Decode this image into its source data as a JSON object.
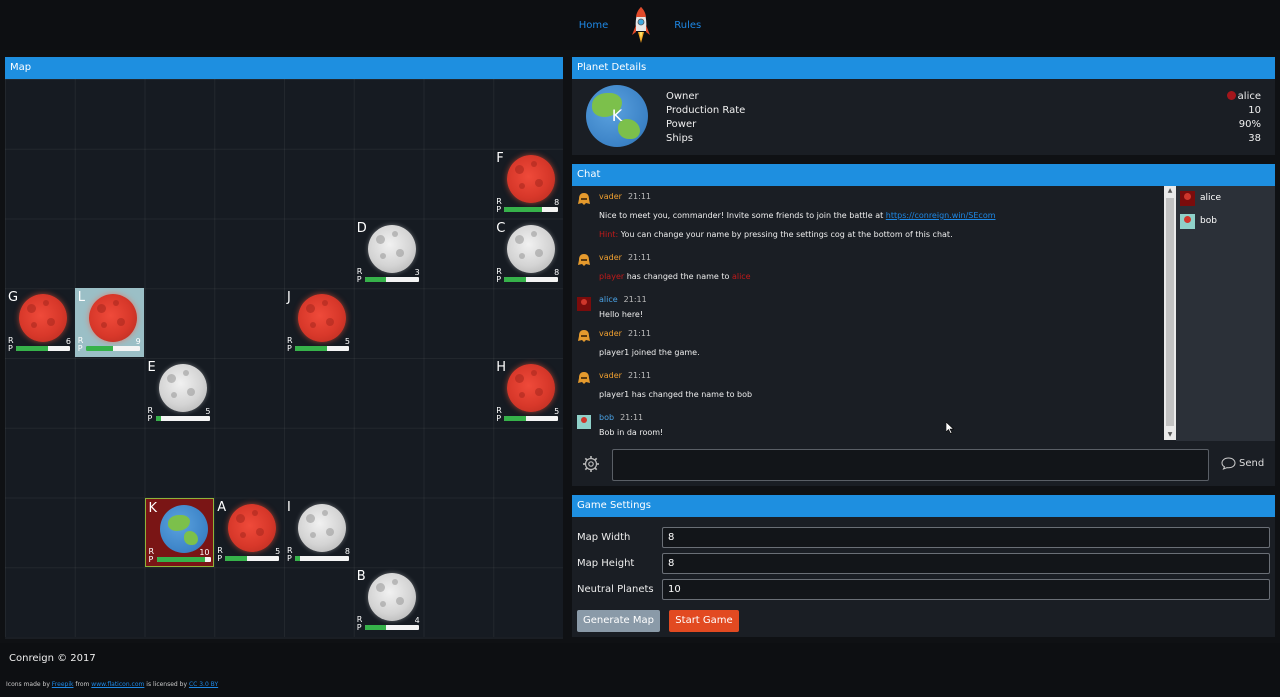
{
  "nav": {
    "home": "Home",
    "rules": "Rules"
  },
  "map": {
    "title": "Map",
    "cells": [
      {
        "letter": "F",
        "col": 7,
        "row": 1,
        "type": "red",
        "ships": "8",
        "production": 0.7
      },
      {
        "letter": "D",
        "col": 5,
        "row": 2,
        "type": "grey",
        "ships": "3",
        "production": 0.4
      },
      {
        "letter": "C",
        "col": 7,
        "row": 2,
        "type": "grey",
        "ships": "8",
        "production": 0.4
      },
      {
        "letter": "G",
        "col": 0,
        "row": 3,
        "type": "red",
        "ships": "6",
        "production": 0.6
      },
      {
        "letter": "L",
        "col": 1,
        "row": 3,
        "type": "red",
        "ships": "9",
        "production": 0.5,
        "highlight": "l"
      },
      {
        "letter": "J",
        "col": 4,
        "row": 3,
        "type": "red",
        "ships": "5",
        "production": 0.6
      },
      {
        "letter": "E",
        "col": 2,
        "row": 4,
        "type": "grey",
        "ships": "5",
        "production": 0.1
      },
      {
        "letter": "H",
        "col": 7,
        "row": 4,
        "type": "red",
        "ships": "5",
        "production": 0.4
      },
      {
        "letter": "K",
        "col": 2,
        "row": 6,
        "type": "earth",
        "ships": "10",
        "production": 0.9,
        "highlight": "k"
      },
      {
        "letter": "A",
        "col": 3,
        "row": 6,
        "type": "red",
        "ships": "5",
        "production": 0.4
      },
      {
        "letter": "I",
        "col": 4,
        "row": 6,
        "type": "grey",
        "ships": "8",
        "production": 0.1
      },
      {
        "letter": "B",
        "col": 5,
        "row": 7,
        "type": "grey",
        "ships": "4",
        "production": 0.4
      }
    ],
    "r_label": "R",
    "p_label": "P"
  },
  "details": {
    "title": "Planet Details",
    "planet_letter": "K",
    "labels": [
      "Owner",
      "Production Rate",
      "Power",
      "Ships"
    ],
    "owner": "alice",
    "production_rate": "10",
    "power": "90%",
    "ships": "38"
  },
  "chat": {
    "title": "Chat",
    "messages": {
      "m1_name": "vader",
      "m1_time": "21:11",
      "m1_text": "Nice to meet you, commander! Invite some friends to join the battle at",
      "m1_link": "https://conreign.win/SEcom",
      "m1_hint_label": "Hint:",
      "m1_hint": "You can change your name by pressing the settings cog at the bottom of this chat.",
      "m2_name": "vader",
      "m2_time": "21:11",
      "m2_old": "player",
      "m2_text": "has changed the name to",
      "m2_new": "alice",
      "m3_name": "alice",
      "m3_time": "21:11",
      "m3_text": "Hello here!",
      "m4_name": "vader",
      "m4_time": "21:11",
      "m4_text": "player1 joined the game.",
      "m5_name": "vader",
      "m5_time": "21:11",
      "m5_text": "player1 has changed the name to bob",
      "m6_name": "bob",
      "m6_time": "21:11",
      "m6_text": "Bob in da room!"
    },
    "users": [
      "alice",
      "bob"
    ],
    "input_value": "",
    "send_label": "Send"
  },
  "settings": {
    "title": "Game Settings",
    "map_width_label": "Map Width",
    "map_width": "8",
    "map_height_label": "Map Height",
    "map_height": "8",
    "neutral_label": "Neutral Planets",
    "neutral": "10",
    "generate_label": "Generate Map",
    "start_label": "Start Game"
  },
  "footer": {
    "copyright": "Conreign © 2017",
    "credits_prefix": "Icons made by",
    "credits_author": "Freepik",
    "credits_from": "from",
    "credits_site": "www.flaticon.com",
    "credits_licensed": "is licensed by",
    "credits_license": "CC 3.0 BY"
  },
  "colors": {
    "accent": "#1e8fe0",
    "start": "#e24a21",
    "generate": "#8a9aa8",
    "alice": "#a3161b",
    "bob": "#8fd1c9"
  }
}
